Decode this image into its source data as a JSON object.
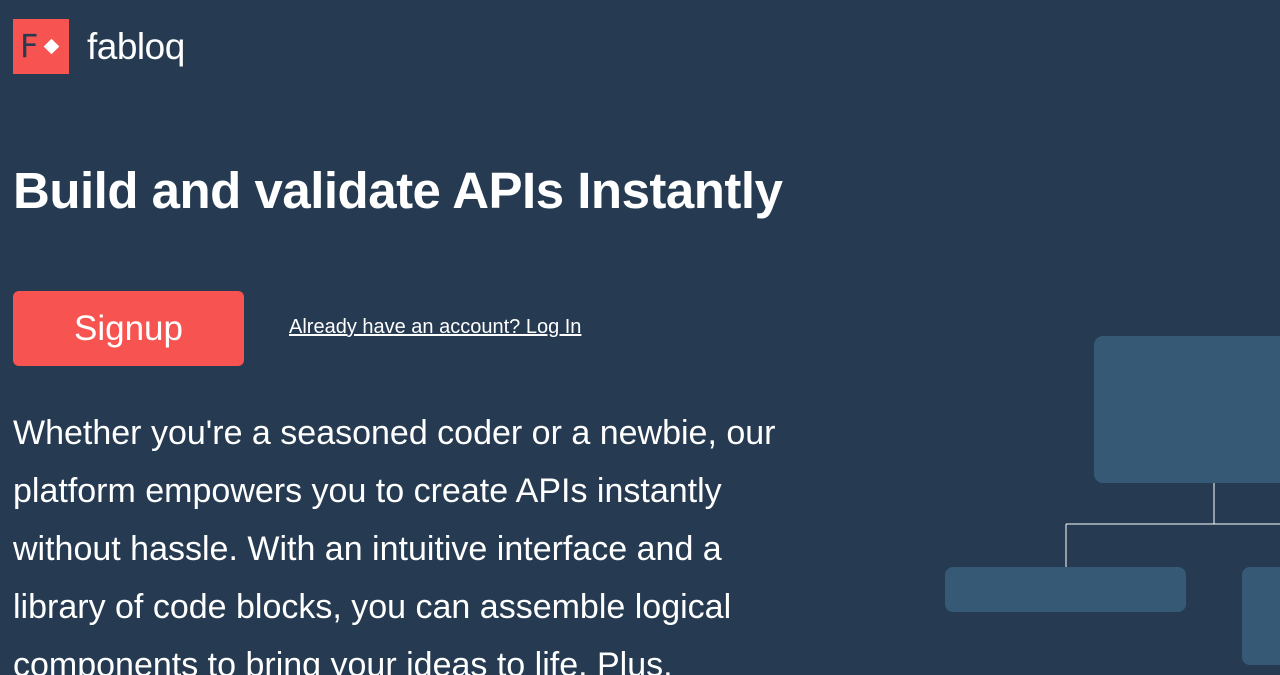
{
  "brand": {
    "name": "fabloq",
    "mark_letter": "F",
    "accent_color": "#f75451",
    "background_color": "#263b52",
    "block_color": "#365a76"
  },
  "hero": {
    "title": "Build and validate APIs Instantly",
    "signup_label": "Signup",
    "login_link": "Already have an account? Log In",
    "description": "Whether you're a seasoned coder or a newbie, our platform empowers you to create APIs instantly without hassle. With an intuitive interface and a library of code blocks, you can assemble logical components to bring your ideas to life. Plus,"
  }
}
